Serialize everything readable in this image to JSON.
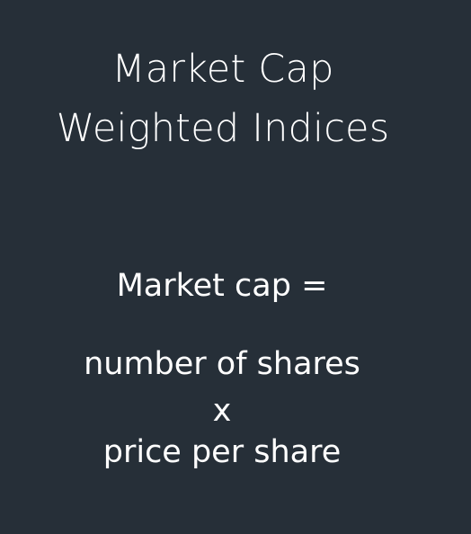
{
  "slide": {
    "title_line_1": "Market Cap",
    "title_line_2": "Weighted Indices",
    "formula": {
      "lhs": "Market cap =",
      "term_1": "number of shares",
      "operator": "x",
      "term_2": "price per share"
    }
  },
  "colors": {
    "background": "#262f38",
    "text": "#ffffff"
  }
}
